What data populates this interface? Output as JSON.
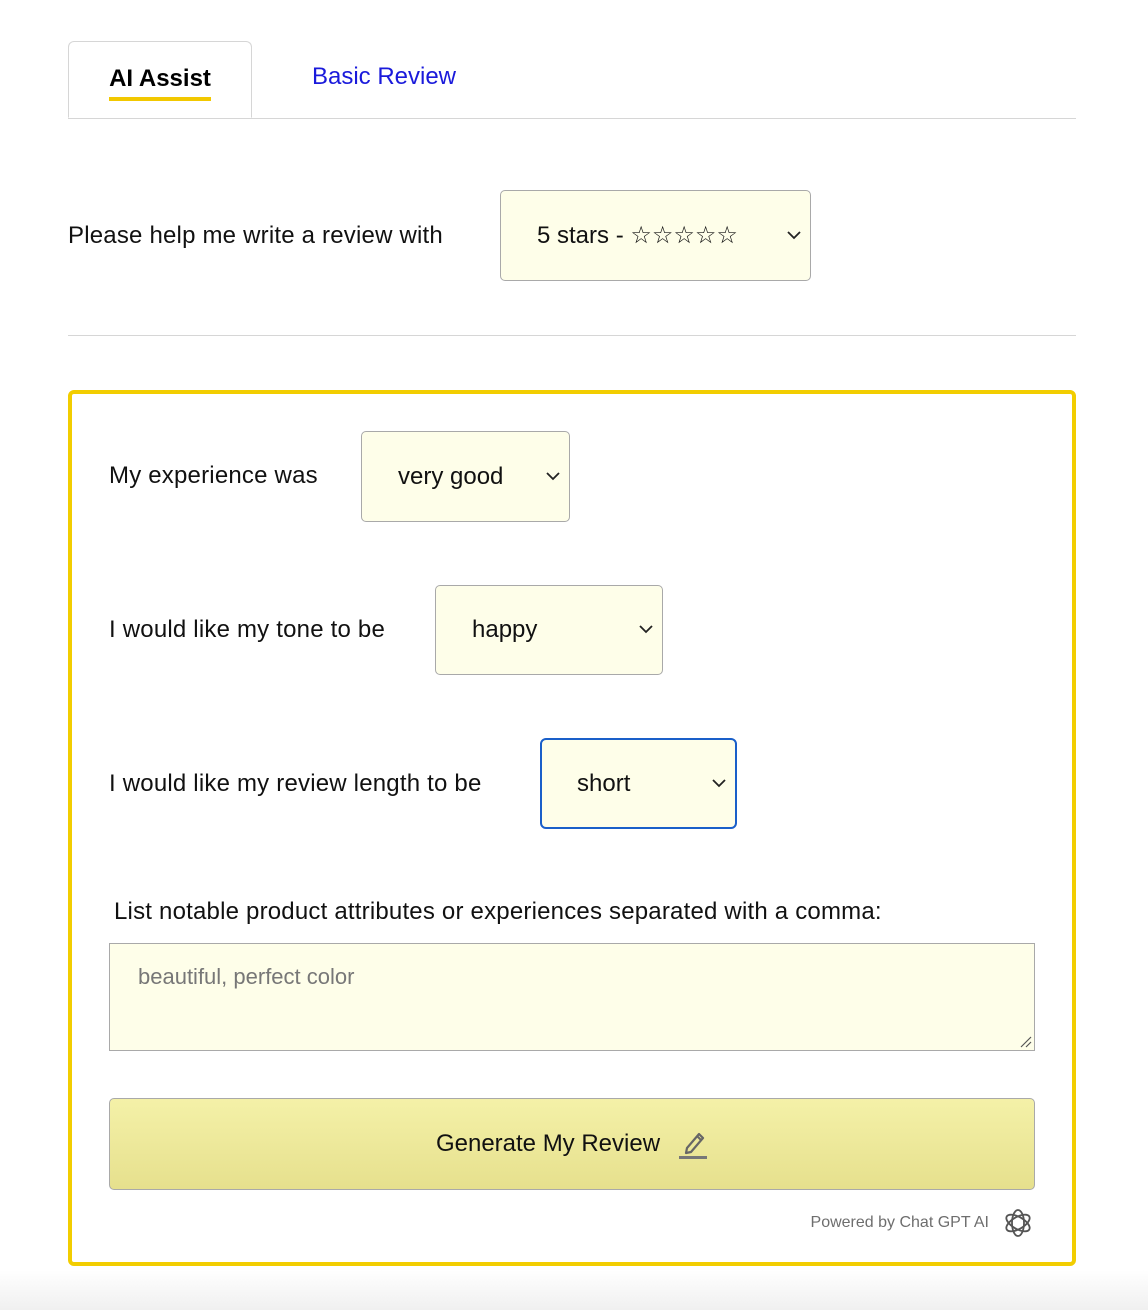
{
  "tabs": [
    {
      "label": "AI Assist",
      "active": true
    },
    {
      "label": "Basic Review",
      "active": false
    }
  ],
  "star_prompt": {
    "label": "Please help me write a review with",
    "selected": "5 stars - ☆☆☆☆☆"
  },
  "experience": {
    "label": "My experience was",
    "selected": "very good"
  },
  "tone": {
    "label": "I would like my tone to be",
    "selected": "happy"
  },
  "length": {
    "label": "I would like my review length to be",
    "selected": "short"
  },
  "attributes": {
    "label": "List notable product attributes or experiences separated with a comma:",
    "placeholder": "beautiful, perfect color",
    "value": ""
  },
  "generate_button": {
    "label": "Generate My Review",
    "icon": "pencil-icon"
  },
  "powered_by": {
    "text": "Powered by Chat GPT AI",
    "icon": "openai-icon"
  },
  "colors": {
    "accent_yellow": "#f2cd00",
    "link_blue": "#1a1adb",
    "field_bg": "#fefee9",
    "focus_blue": "#1a5fc9"
  }
}
